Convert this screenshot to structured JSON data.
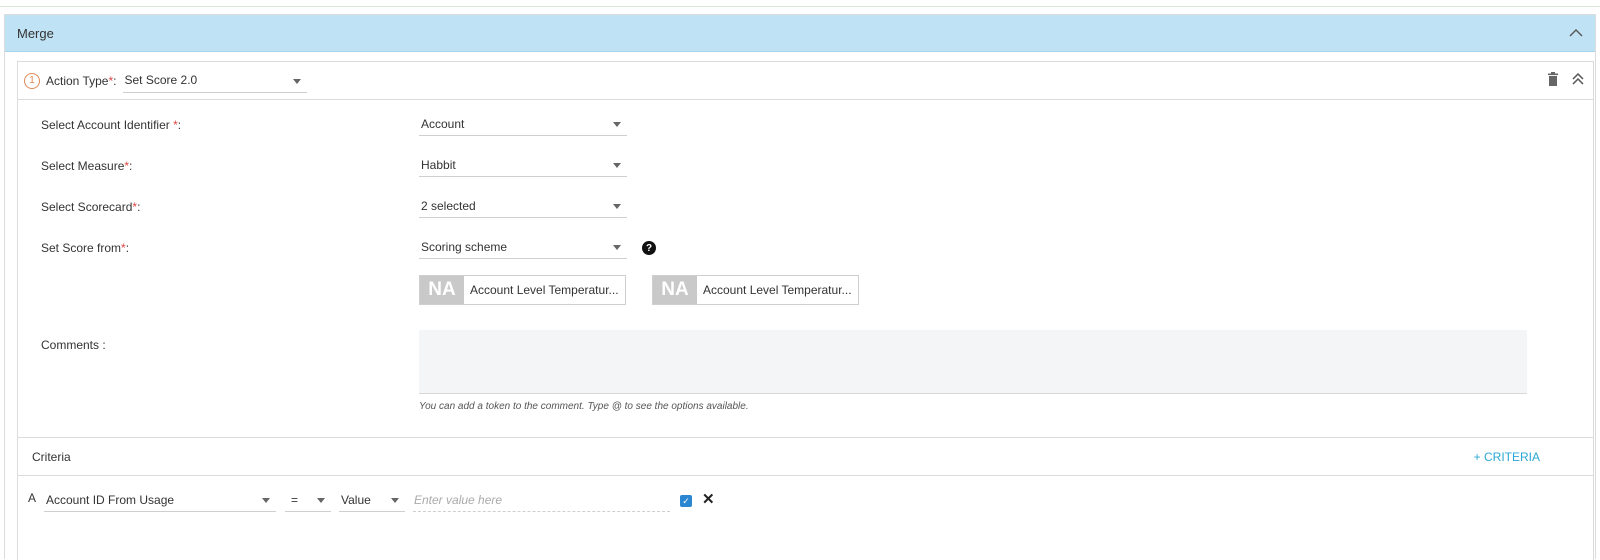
{
  "panel": {
    "title": "Merge"
  },
  "action": {
    "step": "1",
    "label": "Action Type",
    "required": "*",
    "colon": ":",
    "value": "Set Score 2.0"
  },
  "form": {
    "account_identifier": {
      "label": "Select Account Identifier ",
      "req": "*",
      "colon": ":",
      "value": "Account"
    },
    "measure": {
      "label": "Select Measure",
      "req": "*",
      "colon": ":",
      "value": "Habbit"
    },
    "scorecard": {
      "label": "Select Scorecard",
      "req": "*",
      "colon": ":",
      "value": "2 selected"
    },
    "score_from": {
      "label": "Set Score from",
      "req": "*",
      "colon": ":",
      "value": "Scoring scheme",
      "help": "?"
    },
    "chips": [
      {
        "badge": "NA",
        "text": "Account Level Temperatur..."
      },
      {
        "badge": "NA",
        "text": "Account Level Temperatur..."
      }
    ],
    "comments": {
      "label": "Comments :",
      "hint": "You can add a token to the comment. Type @ to see the options available."
    }
  },
  "criteria": {
    "title": "Criteria",
    "add_label": "+ CRITERIA",
    "rows": [
      {
        "letter": "A",
        "field": "Account ID From Usage",
        "operator": "=",
        "value_type": "Value",
        "placeholder": "Enter value here",
        "checked": "✓",
        "remove": "✕"
      }
    ]
  },
  "colors": {
    "header_bg": "#bfe3f5",
    "link": "#2aa7d6",
    "required": "#e04444",
    "step_badge": "#e08a57",
    "checkbox": "#2a86d1"
  },
  "icons": [
    "chevron-up-icon",
    "trash-icon",
    "double-chevron-up-icon",
    "help-icon",
    "caret-down-icon",
    "close-icon"
  ]
}
